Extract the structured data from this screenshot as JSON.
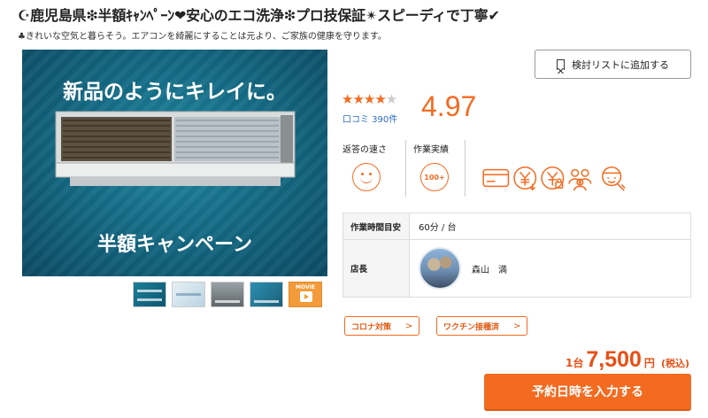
{
  "header": {
    "title": "☪鹿児島県❇半額ｷｬﾝﾍﾟｰﾝ❤安心のエコ洗浄❇プロ技保証✴スピーディで丁寧✔",
    "subtitle": "♣きれいな空気と暮らそう。エアコンを綺麗にすることは元より、ご家族の健康を守ります。"
  },
  "hero": {
    "top_text": "新品のようにキレイに。",
    "bottom_text": "半額キャンペーン"
  },
  "thumbnails": {
    "movie_label": "MOVIE"
  },
  "watchlist": {
    "label": "検討リストに追加する",
    "icon": "bookmark-icon"
  },
  "rating": {
    "stars": "★★★★",
    "star_empty": "★",
    "stars_value": 4,
    "reviews_label": "口コミ 390件",
    "score": "4.97"
  },
  "badges": {
    "response_label": "返答の速さ",
    "track_label": "作業実績",
    "track_value": "100+",
    "services": [
      "credit-card-icon",
      "yen-down-icon",
      "yen-lock-icon",
      "people-icon",
      "fixer-icon"
    ]
  },
  "info": {
    "time_label": "作業時間目安",
    "time_value": "60分 / 台",
    "manager_label": "店長",
    "manager_name": "森山　満"
  },
  "tags": [
    {
      "label": "コロナ対策",
      "chevron": ">"
    },
    {
      "label": "ワクチン接種済",
      "chevron": ">"
    }
  ],
  "price": {
    "unit": "1台",
    "amount": "7,500",
    "yen": "円",
    "tax": "(税込)"
  },
  "cta": {
    "label": "予約日時を入力する"
  },
  "colors": {
    "accent": "#f36b21",
    "link": "#2b6cc4"
  }
}
